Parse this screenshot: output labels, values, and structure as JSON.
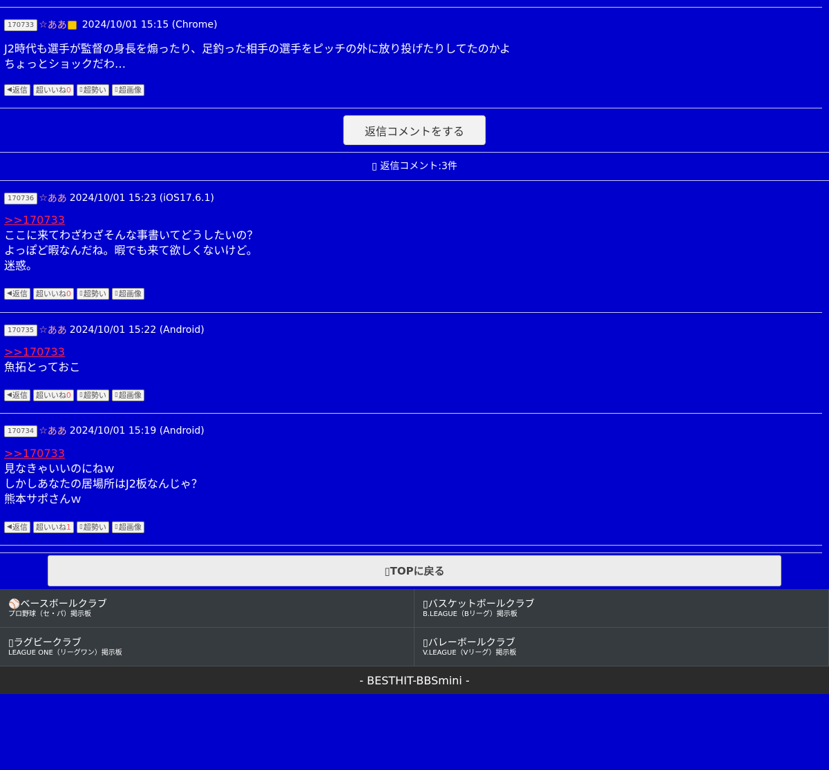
{
  "main_post": {
    "id": "170733",
    "star": "☆",
    "name": "ああ",
    "date": "2024/10/01 15:15 (Chrome)",
    "lines": [
      "J2時代も選手が監督の身長を煽ったり、足釣った相手の選手をピッチの外に放り投げたりしてたのかよ",
      "ちょっとショックだわ…"
    ],
    "actions": {
      "reply": "返信",
      "like": "超いいね",
      "like_count": "0",
      "momentum": "超勢い",
      "image": "超画像"
    }
  },
  "reply_button_label": "返信コメントをする",
  "reply_count_label": "返信コメント:3件",
  "replies": [
    {
      "id": "170736",
      "star": "☆",
      "name": "ああ",
      "date": "2024/10/01 15:23 (iOS17.6.1)",
      "anchor": ">>170733",
      "lines": [
        "ここに来てわざわざそんな事書いてどうしたいの？",
        "よっぽど暇なんだね。暇でも来て欲しくないけど。",
        "迷惑。"
      ],
      "actions": {
        "reply": "返信",
        "like": "超いいね",
        "like_count": "0",
        "momentum": "超勢い",
        "image": "超画像"
      }
    },
    {
      "id": "170735",
      "star": "☆",
      "name": "ああ",
      "date": "2024/10/01 15:22 (Android)",
      "anchor": ">>170733",
      "lines": [
        "魚拓とっておこ"
      ],
      "actions": {
        "reply": "返信",
        "like": "超いいね",
        "like_count": "0",
        "momentum": "超勢い",
        "image": "超画像"
      }
    },
    {
      "id": "170734",
      "star": "☆",
      "name": "ああ",
      "date": "2024/10/01 15:19 (Android)",
      "anchor": ">>170733",
      "lines": [
        "見なきゃいいのにねｗ",
        "しかしあなたの居場所はJ2板なんじゃ？",
        "熊本サポさんｗ"
      ],
      "actions": {
        "reply": "返信",
        "like": "超いいね",
        "like_count": "1",
        "momentum": "超勢い",
        "image": "超画像"
      }
    }
  ],
  "top_button_label": "TOPに戻る",
  "footer_links": [
    {
      "icon": "baseball-icon",
      "title": "ベースボールクラブ",
      "sub": "プロ野球（セ・パ）掲示板"
    },
    {
      "icon": "basketball-icon",
      "title": "バスケットボールクラブ",
      "sub": "B.LEAGUE（Bリーグ）掲示板"
    },
    {
      "icon": "rugby-icon",
      "title": "ラグビークラブ",
      "sub": "LEAGUE ONE（リーグワン）掲示板"
    },
    {
      "icon": "volleyball-icon",
      "title": "バレーボールクラブ",
      "sub": "V.LEAGUE（Vリーグ）掲示板"
    }
  ],
  "site_footer": "- BESTHIT-BBSmini -",
  "colors": {
    "background": "#0000cc",
    "name": "#ffb090",
    "anchor": "#ff2244",
    "footer_bg": "#353b3f"
  }
}
